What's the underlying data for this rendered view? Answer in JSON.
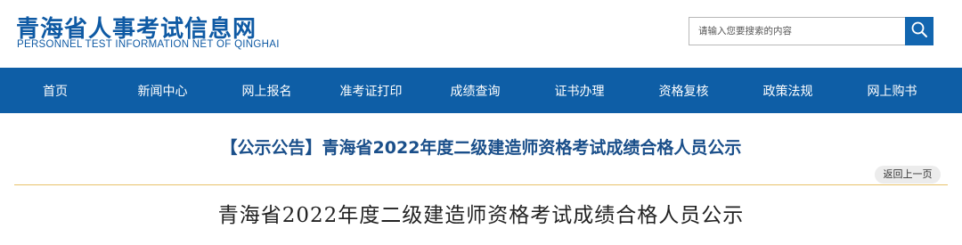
{
  "site": {
    "title_cn": "青海省人事考试信息网",
    "title_en": "PERSONNEL TEST INFORMATION NET OF QINGHAI"
  },
  "search": {
    "placeholder": "请输入您要搜索的内容",
    "icon": "search-icon"
  },
  "nav": {
    "items": [
      {
        "label": "首页"
      },
      {
        "label": "新闻中心"
      },
      {
        "label": "网上报名"
      },
      {
        "label": "准考证打印"
      },
      {
        "label": "成绩查询"
      },
      {
        "label": "证书办理"
      },
      {
        "label": "资格复核"
      },
      {
        "label": "政策法规"
      },
      {
        "label": "网上购书"
      }
    ]
  },
  "notice": {
    "title": "【公示公告】青海省2022年度二级建造师资格考试成绩合格人员公示",
    "back_label": "返回上一页"
  },
  "article": {
    "heading": "青海省2022年度二级建造师资格考试成绩合格人员公示"
  },
  "colors": {
    "brand": "#0f5aa4",
    "nav_bg": "#0e5ea6",
    "divider": "#e8c26a"
  }
}
